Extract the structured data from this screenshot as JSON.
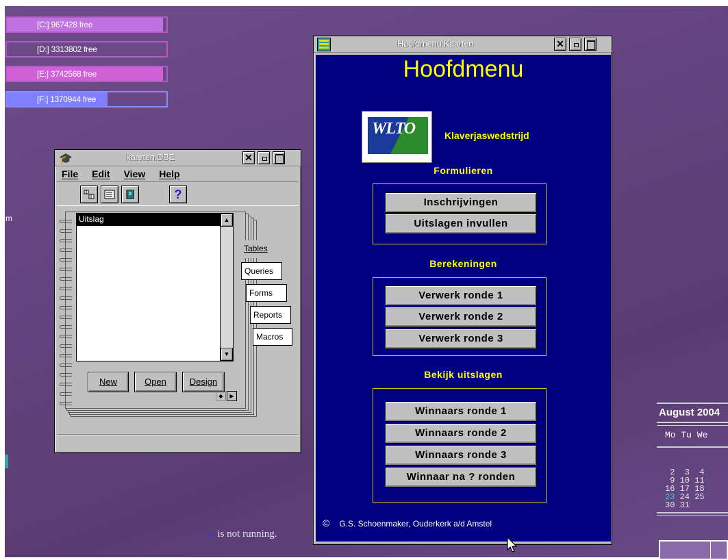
{
  "drives": [
    {
      "label": "[C:] 967428 free",
      "fill": 0.98,
      "color": "#c070e0"
    },
    {
      "label": "[D:] 3313802 free",
      "fill": 0.0,
      "color": "#b050c8"
    },
    {
      "label": "[E:] 3742568 free",
      "fill": 0.98,
      "color": "#d060d8"
    },
    {
      "label": "[F:] 1370944 free",
      "fill": 0.63,
      "color": "#8080ff"
    }
  ],
  "desktop": {
    "left_edge_text": "m",
    "not_running_prefix": "z!",
    "not_running_text": " is not running."
  },
  "dbe_window": {
    "title": "kaarten.DBE",
    "menu": [
      "File",
      "Edit",
      "View",
      "Help"
    ],
    "toolbar_help": "?",
    "list_items": [
      "Uitslag"
    ],
    "tabs": [
      "Tables",
      "Queries",
      "Forms",
      "Reports",
      "Macros"
    ],
    "buttons": {
      "new": "New",
      "open": "Open",
      "design": "Design"
    }
  },
  "hoofdmenu_window": {
    "title": "Hoofdmenu Kaarten",
    "heading": "Hoofdmenu",
    "logo_text": "WLTO",
    "subtitle": "Klaverjaswedstrijd",
    "sections": [
      {
        "label": "Formulieren",
        "buttons": [
          "Inschrijvingen",
          "Uitslagen invullen"
        ]
      },
      {
        "label": "Berekeningen",
        "buttons": [
          "Verwerk ronde 1",
          "Verwerk ronde 2",
          "Verwerk ronde 3"
        ]
      },
      {
        "label": "Bekijk uitslagen",
        "buttons": [
          "Winnaars ronde 1",
          "Winnaars ronde 2",
          "Winnaars ronde 3",
          "Winnaar na ? ronden"
        ]
      }
    ],
    "copyright_symbol": "©",
    "copyright_text": "G.S. Schoenmaker, Ouderkerk a/d Amstel"
  },
  "calendar": {
    "title": "August 2004",
    "header": "Mo Tu We",
    "rows": [
      " 2  3  4",
      " 9 10 11",
      "16 17 18",
      "23 24 25",
      "30 31"
    ],
    "today": "23",
    "today_color": "#40c8c8"
  }
}
